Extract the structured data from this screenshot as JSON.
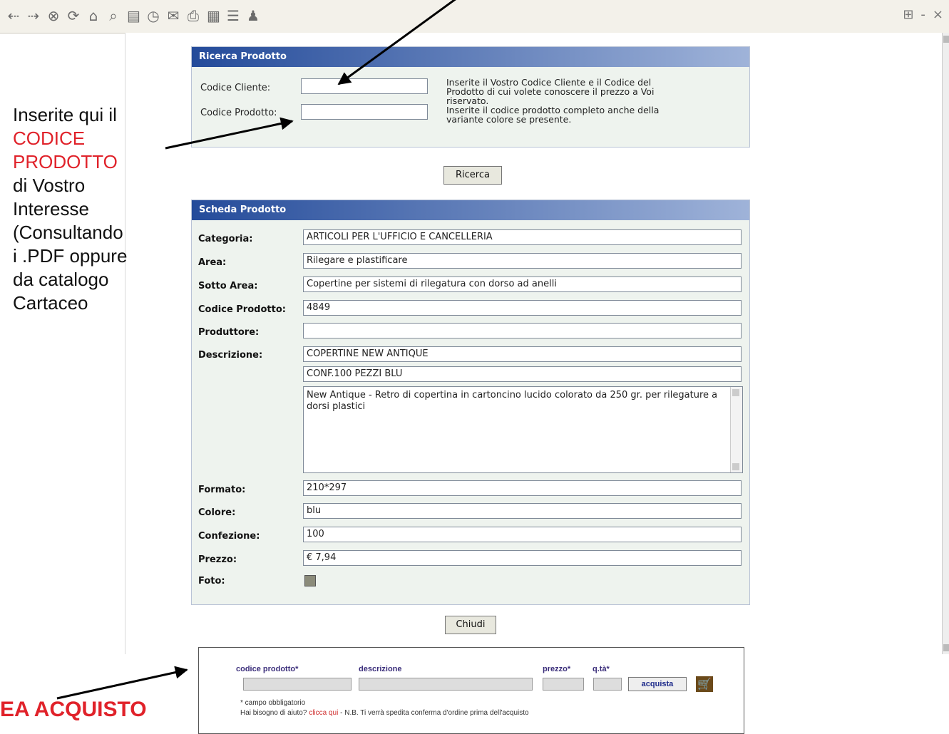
{
  "window": {
    "right_controls": [
      "-",
      "×"
    ]
  },
  "ricerca": {
    "title": "Ricerca Prodotto",
    "codice_cliente_label": "Codice Cliente:",
    "codice_cliente_value": "",
    "codice_prodotto_label": "Codice Prodotto:",
    "codice_prodotto_value": "",
    "help_lines": [
      "Inserite il Vostro Codice Cliente e il Codice del",
      "Prodotto di cui volete conoscere il prezzo a Voi",
      "riservato.",
      "Inserite il codice prodotto completo anche della",
      "variante colore se presente."
    ],
    "button": "Ricerca"
  },
  "scheda": {
    "title": "Scheda Prodotto",
    "fields": {
      "categoria": {
        "label": "Categoria:",
        "value": "ARTICOLI PER L'UFFICIO E CANCELLERIA"
      },
      "area": {
        "label": "Area:",
        "value": "Rilegare e plastificare"
      },
      "sotto_area": {
        "label": "Sotto Area:",
        "value": "Copertine per sistemi di rilegatura con dorso ad anelli"
      },
      "codice_prodotto": {
        "label": "Codice Prodotto:",
        "value": "4849"
      },
      "produttore": {
        "label": "Produttore:",
        "value": ""
      },
      "descrizione": {
        "label": "Descrizione:",
        "line1": "COPERTINE NEW ANTIQUE",
        "line2": "CONF.100 PEZZI BLU",
        "text": "New Antique - Retro di copertina in cartoncino lucido colorato da 250 gr. per rilegature a dorsi plastici"
      },
      "formato": {
        "label": "Formato:",
        "value": "210*297"
      },
      "colore": {
        "label": "Colore:",
        "value": "blu"
      },
      "confezione": {
        "label": "Confezione:",
        "value": "100"
      },
      "prezzo": {
        "label": "Prezzo:",
        "value": "€ 7,94"
      },
      "foto": {
        "label": "Foto:",
        "icon": "photo-icon"
      }
    },
    "button": "Chiudi"
  },
  "annotation": {
    "line1": "Inserite qui il",
    "red1": "CODICE",
    "red2": "PRODOTTO",
    "rest": [
      "di Vostro",
      "Interesse",
      "(Consultando",
      "i .PDF oppure",
      "da catalogo",
      "Cartaceo"
    ]
  },
  "acquisto": {
    "headers": {
      "codice": "codice prodotto*",
      "descrizione": "descrizione",
      "prezzo": "prezzo*",
      "qta": "q.tà*"
    },
    "button": "acquista",
    "cart_icon": "cart-icon",
    "note1": "* campo obbligatorio",
    "note2_prefix": "Hai bisogno di aiuto?",
    "note2_link": "clicca qui",
    "note2_suffix": "- N.B. Ti verrà spedita conferma d'ordine prima dell'acquisto"
  },
  "bottom_caption": "EA ACQUISTO"
}
